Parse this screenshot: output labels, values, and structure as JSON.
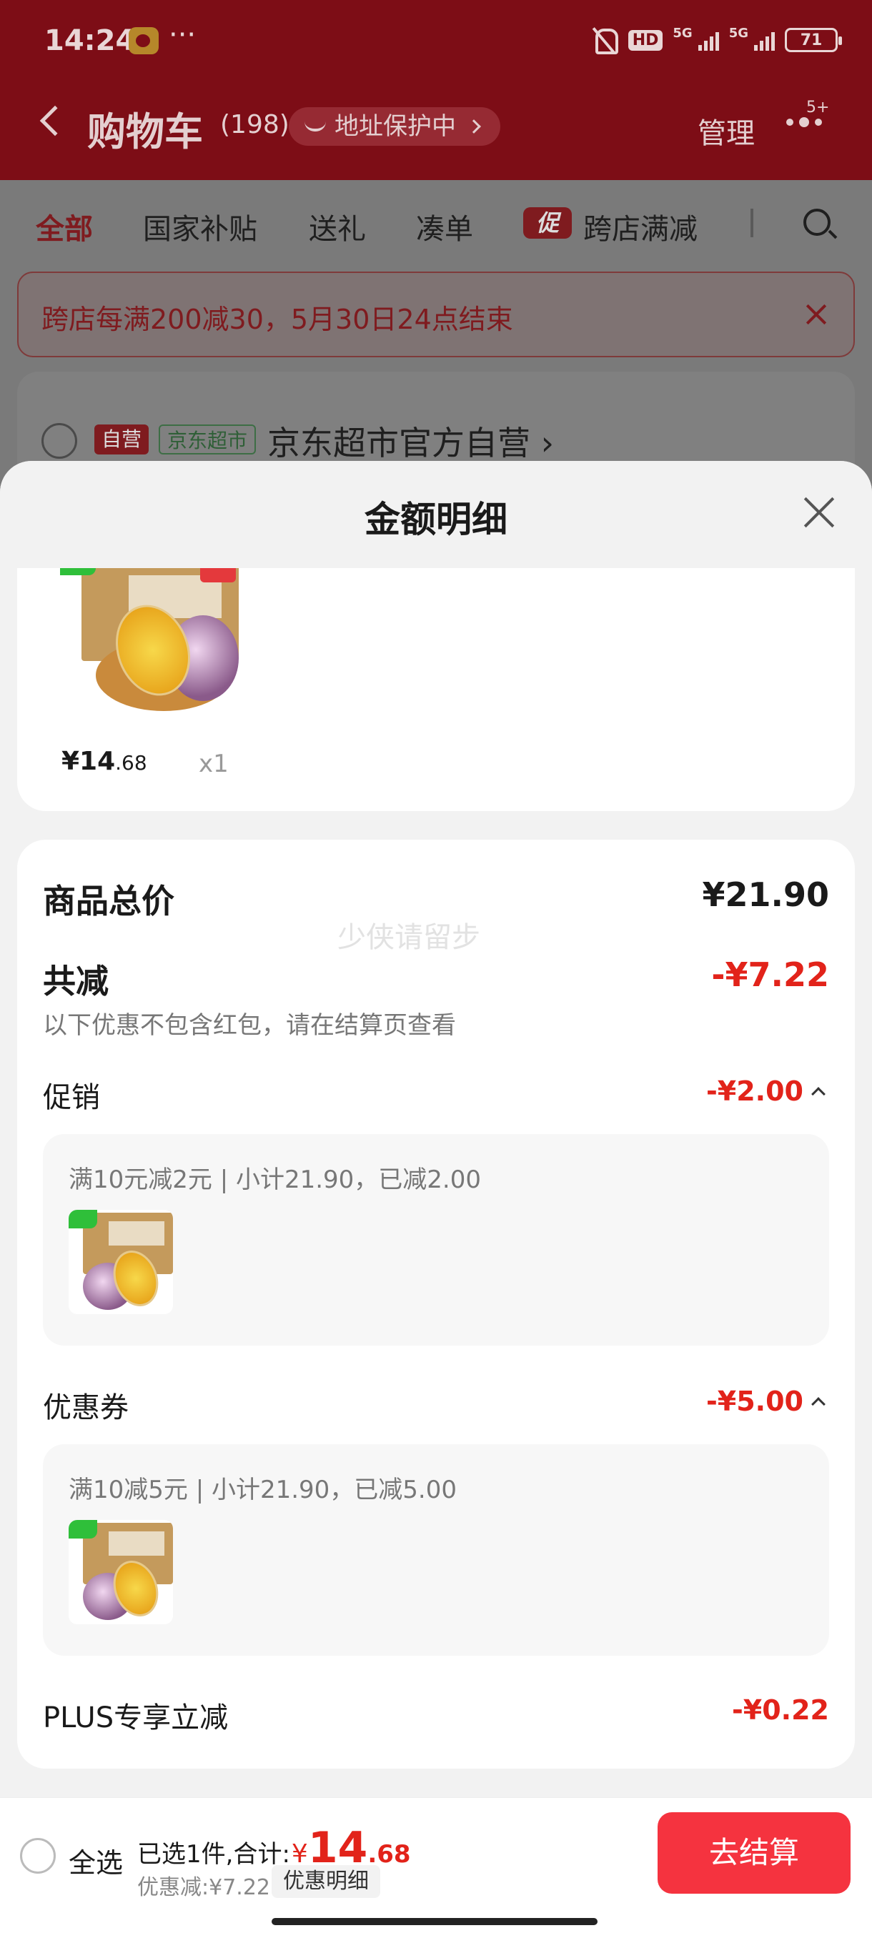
{
  "status_bar": {
    "time": "14:24",
    "more": "···",
    "hd": "HD",
    "sig1": "5G",
    "sig2": "5G",
    "battery": "71"
  },
  "nav": {
    "title": "购物车",
    "count": "(198)",
    "address_pill": "地址保护中",
    "manage": "管理",
    "badge": "5+"
  },
  "tabs": [
    {
      "label": "全部"
    },
    {
      "label": "国家补贴"
    },
    {
      "label": "送礼"
    },
    {
      "label": "凑单"
    },
    {
      "label": "跨店满减",
      "badge": "促"
    }
  ],
  "promo_banner": {
    "text": "跨店每满200减30，5月30日24点结束"
  },
  "store": {
    "tag_self": "自营",
    "tag_market": "京东超市",
    "name": "京东超市官方自营 ›"
  },
  "sheet": {
    "title": "金额明细",
    "item": {
      "price_main": "¥14",
      "price_decimal": ".68",
      "qty": "x1"
    },
    "watermark": "少侠请留步",
    "total": {
      "label": "商品总价",
      "value": "¥21.90"
    },
    "discount": {
      "label": "共减",
      "value": "-¥7.22",
      "note": "以下优惠不包含红包，请在结算页查看"
    },
    "promotion": {
      "label": "促销",
      "value": "-¥2.00",
      "detail": "满10元减2元 | 小计21.90，已减2.00"
    },
    "coupon": {
      "label": "优惠券",
      "value": "-¥5.00",
      "detail": "满10减5元 | 小计21.90，已减5.00"
    },
    "plus": {
      "label": "PLUS专享立减",
      "value": "-¥0.22"
    }
  },
  "bottom": {
    "select_all": "全选",
    "selected_text": "已选1件,合计:",
    "currency": "¥",
    "total_main": "14",
    "total_decimal": ".68",
    "saved": "优惠减:¥7.22",
    "detail_button": "优惠明细",
    "checkout": "去结算"
  },
  "colors": {
    "brand_red": "#e2231a",
    "checkout_red": "#f5333f"
  }
}
